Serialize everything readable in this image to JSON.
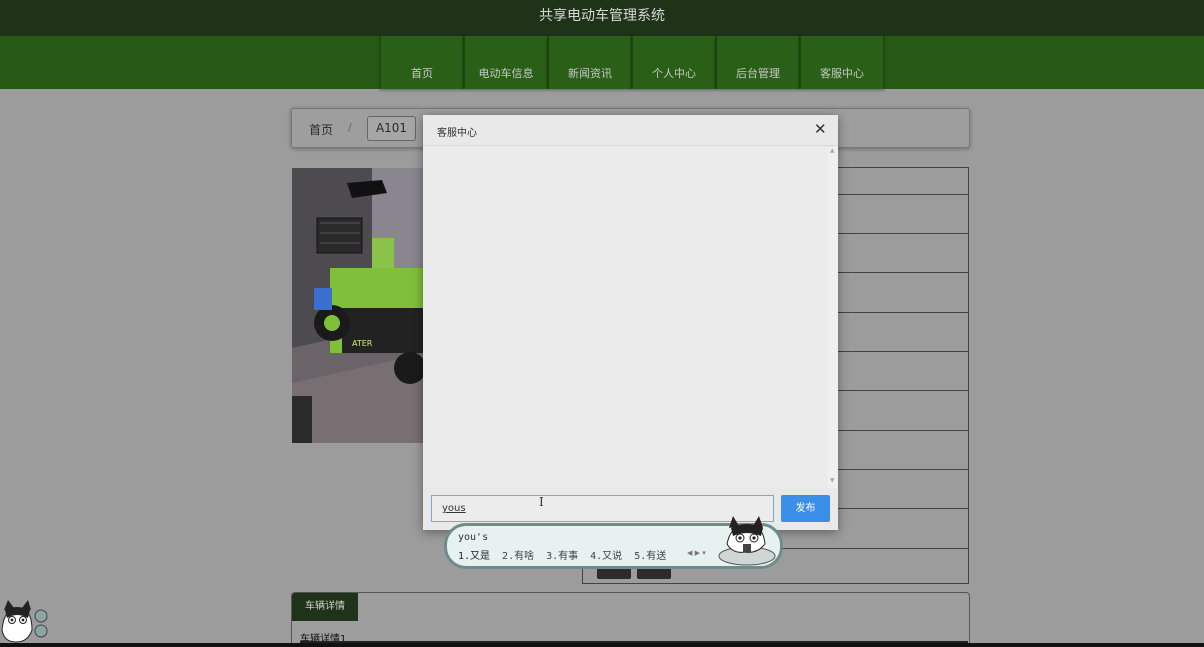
{
  "header": {
    "title": "共享电动车管理系统"
  },
  "nav": {
    "items": [
      {
        "label": "首页",
        "id": "home"
      },
      {
        "label": "电动车信息",
        "id": "bikes"
      },
      {
        "label": "新闻资讯",
        "id": "news"
      },
      {
        "label": "个人中心",
        "id": "profile"
      },
      {
        "label": "后台管理",
        "id": "admin"
      },
      {
        "label": "客服中心",
        "id": "support"
      }
    ]
  },
  "breadcrumb": {
    "home": "首页",
    "separator": "/",
    "current": "A101"
  },
  "details": {
    "tab_label": "车辆详情",
    "text": "车辆详情1"
  },
  "modal": {
    "title": "客服中心",
    "close_glyph": "✕",
    "input_value": "yous",
    "send_label": "发布"
  },
  "ime": {
    "composition": "you's",
    "candidates": [
      "1.又是",
      "2.有啥",
      "3.有事",
      "4.又说",
      "5.有送"
    ],
    "arrows": "◀ ▶ ▾"
  },
  "colors": {
    "topbar": "#1f3319",
    "navbar": "#275a14",
    "send_button": "#3b8fe8",
    "modal_bg": "#e9e9e9"
  }
}
